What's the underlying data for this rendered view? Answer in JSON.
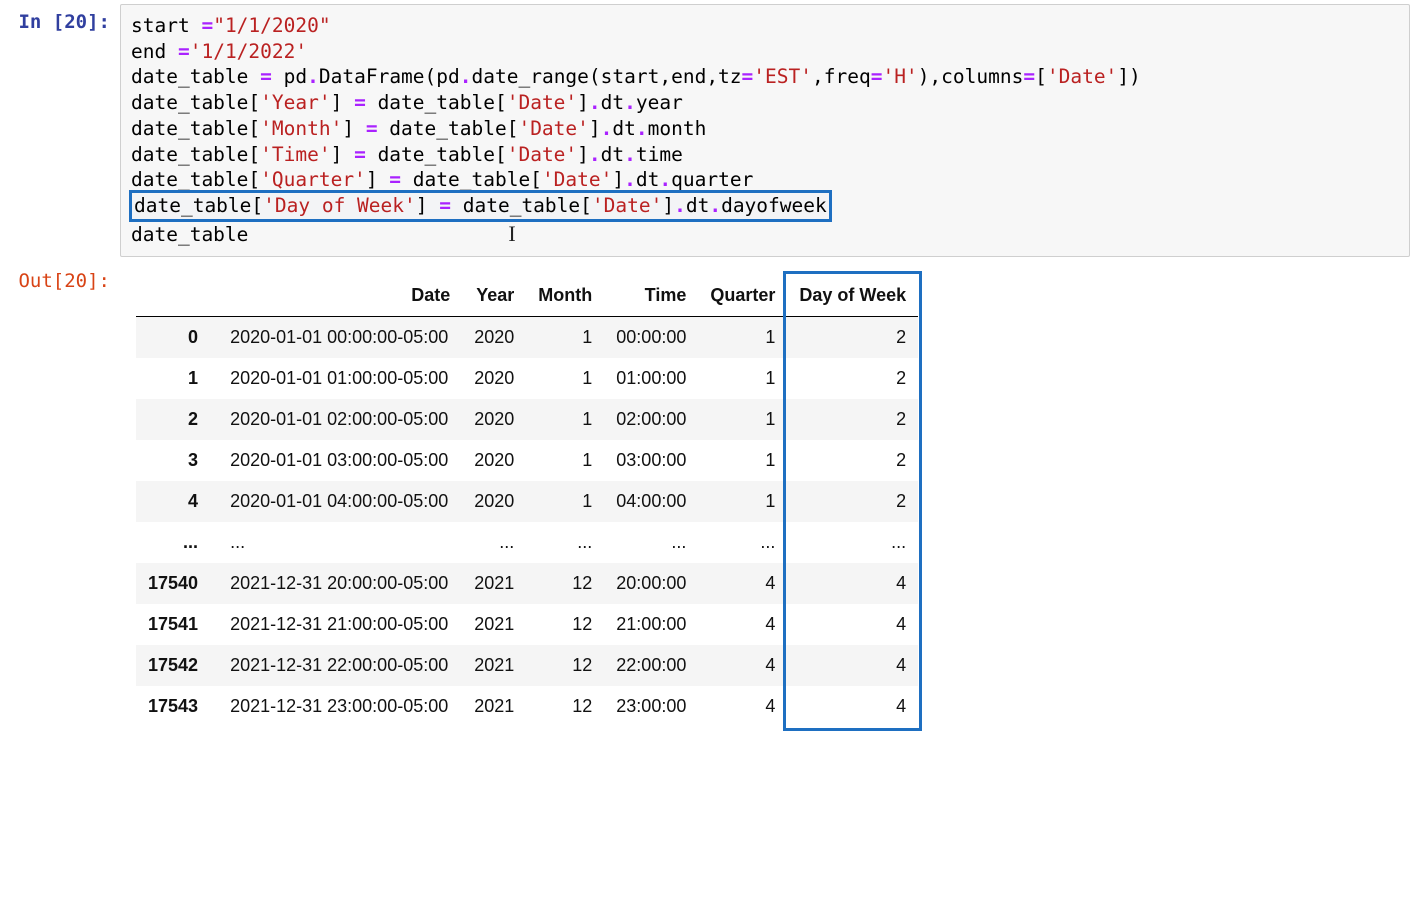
{
  "in_prompt": "In [20]:",
  "out_prompt": "Out[20]:",
  "code": {
    "l1a": "start ",
    "l1b": "=",
    "l1c": "\"1/1/2020\"",
    "l2a": "end ",
    "l2b": "=",
    "l2c": "'1/1/2022'",
    "l3a": "date_table ",
    "l3b": "=",
    "l3c": " pd",
    "l3d": ".",
    "l3e": "DataFrame(pd",
    "l3f": ".",
    "l3g": "date_range(start,end,tz",
    "l3h": "=",
    "l3i": "'EST'",
    "l3j": ",freq",
    "l3k": "=",
    "l3l": "'H'",
    "l3m": "),columns",
    "l3n": "=",
    "l3o": "[",
    "l3p": "'Date'",
    "l3q": "])",
    "l4a": "date_table[",
    "l4b": "'Year'",
    "l4c": "] ",
    "l4d": "=",
    "l4e": " date_table[",
    "l4f": "'Date'",
    "l4g": "]",
    "l4h": ".",
    "l4i": "dt",
    "l4j": ".",
    "l4k": "year",
    "l5a": "date_table[",
    "l5b": "'Month'",
    "l5c": "] ",
    "l5d": "=",
    "l5e": " date_table[",
    "l5f": "'Date'",
    "l5g": "]",
    "l5h": ".",
    "l5i": "dt",
    "l5j": ".",
    "l5k": "month",
    "l6a": "date_table[",
    "l6b": "'Time'",
    "l6c": "] ",
    "l6d": "=",
    "l6e": " date_table[",
    "l6f": "'Date'",
    "l6g": "]",
    "l6h": ".",
    "l6i": "dt",
    "l6j": ".",
    "l6k": "time",
    "l7a": "date_table[",
    "l7b": "'Quarter'",
    "l7c": "] ",
    "l7d": "=",
    "l7e": " date_table[",
    "l7f": "'Date'",
    "l7g": "]",
    "l7h": ".",
    "l7i": "dt",
    "l7j": ".",
    "l7k": "quarter",
    "l8a": "date_table[",
    "l8b": "'Day of Week'",
    "l8c": "] ",
    "l8d": "=",
    "l8e": " date_table[",
    "l8f": "'Date'",
    "l8g": "]",
    "l8h": ".",
    "l8i": "dt",
    "l8j": ".",
    "l8k": "dayofweek",
    "l9": "date_table"
  },
  "table": {
    "columns": [
      "",
      "Date",
      "Year",
      "Month",
      "Time",
      "Quarter",
      "Day of Week"
    ],
    "rows": [
      {
        "idx": "0",
        "date": "2020-01-01 00:00:00-05:00",
        "year": "2020",
        "month": "1",
        "time": "00:00:00",
        "quarter": "1",
        "dow": "2"
      },
      {
        "idx": "1",
        "date": "2020-01-01 01:00:00-05:00",
        "year": "2020",
        "month": "1",
        "time": "01:00:00",
        "quarter": "1",
        "dow": "2"
      },
      {
        "idx": "2",
        "date": "2020-01-01 02:00:00-05:00",
        "year": "2020",
        "month": "1",
        "time": "02:00:00",
        "quarter": "1",
        "dow": "2"
      },
      {
        "idx": "3",
        "date": "2020-01-01 03:00:00-05:00",
        "year": "2020",
        "month": "1",
        "time": "03:00:00",
        "quarter": "1",
        "dow": "2"
      },
      {
        "idx": "4",
        "date": "2020-01-01 04:00:00-05:00",
        "year": "2020",
        "month": "1",
        "time": "04:00:00",
        "quarter": "1",
        "dow": "2"
      },
      {
        "idx": "...",
        "date": "...",
        "year": "...",
        "month": "...",
        "time": "...",
        "quarter": "...",
        "dow": "..."
      },
      {
        "idx": "17540",
        "date": "2021-12-31 20:00:00-05:00",
        "year": "2021",
        "month": "12",
        "time": "20:00:00",
        "quarter": "4",
        "dow": "4"
      },
      {
        "idx": "17541",
        "date": "2021-12-31 21:00:00-05:00",
        "year": "2021",
        "month": "12",
        "time": "21:00:00",
        "quarter": "4",
        "dow": "4"
      },
      {
        "idx": "17542",
        "date": "2021-12-31 22:00:00-05:00",
        "year": "2021",
        "month": "12",
        "time": "22:00:00",
        "quarter": "4",
        "dow": "4"
      },
      {
        "idx": "17543",
        "date": "2021-12-31 23:00:00-05:00",
        "year": "2021",
        "month": "12",
        "time": "23:00:00",
        "quarter": "4",
        "dow": "4"
      }
    ]
  }
}
